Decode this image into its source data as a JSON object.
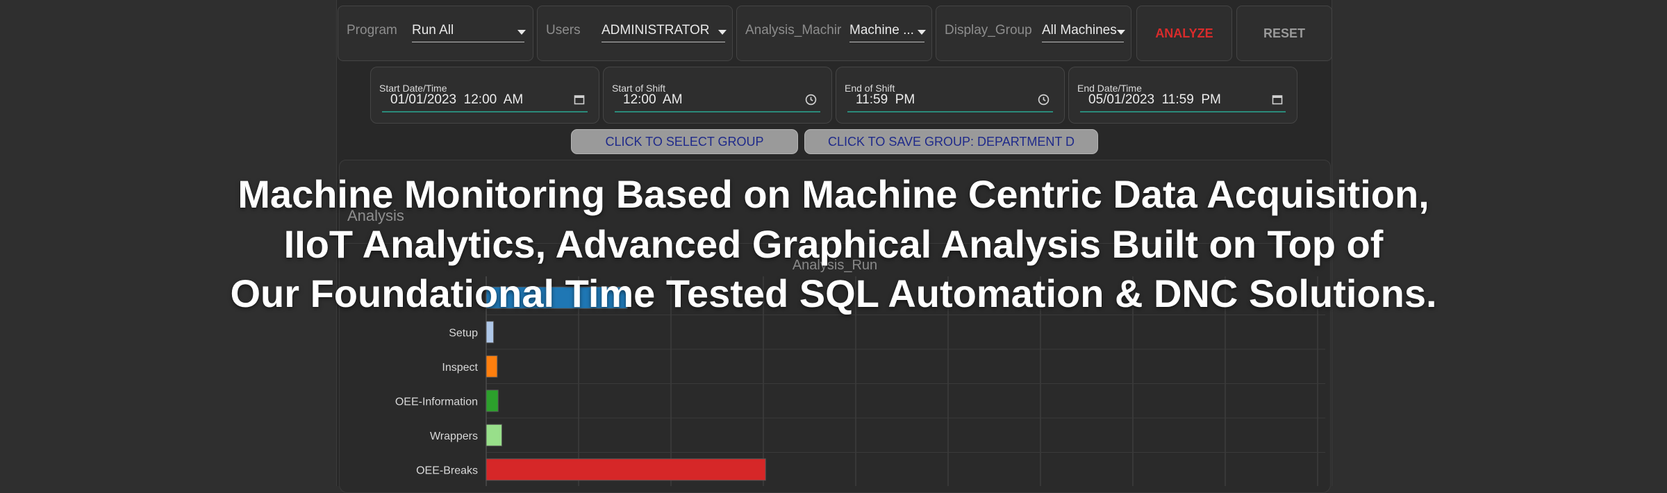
{
  "filters": [
    {
      "label": "Program",
      "value": "Run All"
    },
    {
      "label": "Users",
      "value": "ADMINISTRATOR"
    },
    {
      "label": "Analysis_Machir",
      "value": "Machine ..."
    },
    {
      "label": "Display_Group",
      "value": "All Machines"
    }
  ],
  "buttons": {
    "analyze": "ANALYZE",
    "reset": "RESET",
    "select_group": "CLICK TO SELECT GROUP",
    "save_group": "CLICK TO SAVE GROUP: DEPARTMENT D"
  },
  "dates": [
    {
      "label": "Start Date/Time",
      "value": "01/01/2023  12:00  AM",
      "icon": "calendar-icon"
    },
    {
      "label": "Start of Shift",
      "value": "12:00  AM",
      "icon": "clock-icon"
    },
    {
      "label": "End of Shift",
      "value": "11:59  PM",
      "icon": "clock-icon"
    },
    {
      "label": "End Date/Time",
      "value": "05/01/2023  11:59  PM",
      "icon": "calendar-icon"
    }
  ],
  "analysis": {
    "title": "Analysis"
  },
  "overlay": {
    "line1": "Machine Monitoring Based on Machine Centric Data Acquisition,",
    "line2": "IIoT Analytics, Advanced Graphical Analysis Built on Top of",
    "line3": "Our Foundational Time Tested SQL Automation & DNC Solutions."
  },
  "colors": {
    "analyze": "#d92b2b",
    "reset": "#9a9a9a",
    "pill_text": "#1f2a8a",
    "teal": "#2b8a7a"
  },
  "chart_data": {
    "type": "bar",
    "orientation": "horizontal",
    "title": "Analysis_Run",
    "categories": [
      "Run",
      "Setup",
      "Inspect",
      "OEE-Information",
      "Wrappers",
      "OEE-Breaks"
    ],
    "category_labels_visible": [
      "",
      "Setup",
      "Inspect",
      "OEE-Information",
      "Wrappers",
      "OEE-Breaks"
    ],
    "values": [
      1.53,
      0.08,
      0.12,
      0.13,
      0.17,
      3.03
    ],
    "colors": [
      "#1f77b4",
      "#aec7e8",
      "#ff7f0e",
      "#2ca02c",
      "#98df8a",
      "#d62728"
    ],
    "xlim": [
      0,
      9.1
    ],
    "grid": true
  }
}
